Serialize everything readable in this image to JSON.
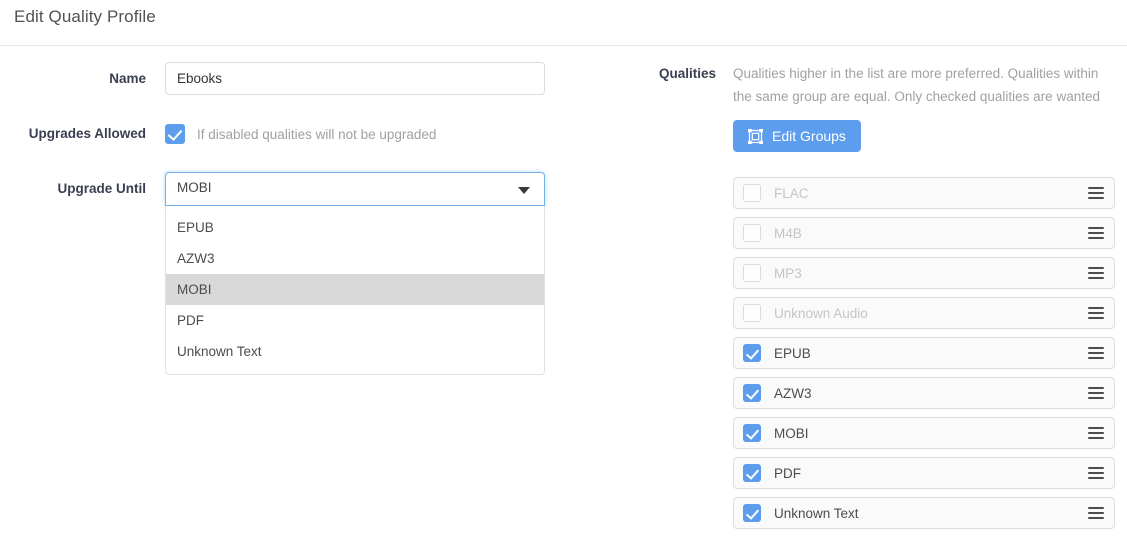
{
  "header": {
    "title": "Edit Quality Profile"
  },
  "form": {
    "name": {
      "label": "Name",
      "value": "Ebooks",
      "placeholder": ""
    },
    "upgrades_allowed": {
      "label": "Upgrades Allowed",
      "checked": true,
      "help": "If disabled qualities will not be upgraded"
    },
    "upgrade_until": {
      "label": "Upgrade Until",
      "value": "MOBI",
      "open": true,
      "options": [
        {
          "label": "EPUB",
          "selected": false
        },
        {
          "label": "AZW3",
          "selected": false
        },
        {
          "label": "MOBI",
          "selected": true
        },
        {
          "label": "PDF",
          "selected": false
        },
        {
          "label": "Unknown Text",
          "selected": false
        }
      ]
    }
  },
  "qualities": {
    "label": "Qualities",
    "help": "Qualities higher in the list are more preferred. Qualities within the same group are equal. Only checked qualities are wanted",
    "edit_groups_label": "Edit Groups",
    "edit_groups_icon": "object-group-icon",
    "drag_handle_icon": "drag-handle-icon",
    "items": [
      {
        "label": "FLAC",
        "checked": false
      },
      {
        "label": "M4B",
        "checked": false
      },
      {
        "label": "MP3",
        "checked": false
      },
      {
        "label": "Unknown Audio",
        "checked": false
      },
      {
        "label": "EPUB",
        "checked": true
      },
      {
        "label": "AZW3",
        "checked": true
      },
      {
        "label": "MOBI",
        "checked": true
      },
      {
        "label": "PDF",
        "checked": true
      },
      {
        "label": "Unknown Text",
        "checked": true
      }
    ]
  },
  "colors": {
    "accent": "#5c9ded",
    "title": "#515253",
    "label": "#3a3f51",
    "muted": "#9fa1a4",
    "disabled_text": "#c3c5c7",
    "row_bg": "#fafafa",
    "row_border": "#dededf",
    "option_selected_bg": "#d9d9d9"
  }
}
